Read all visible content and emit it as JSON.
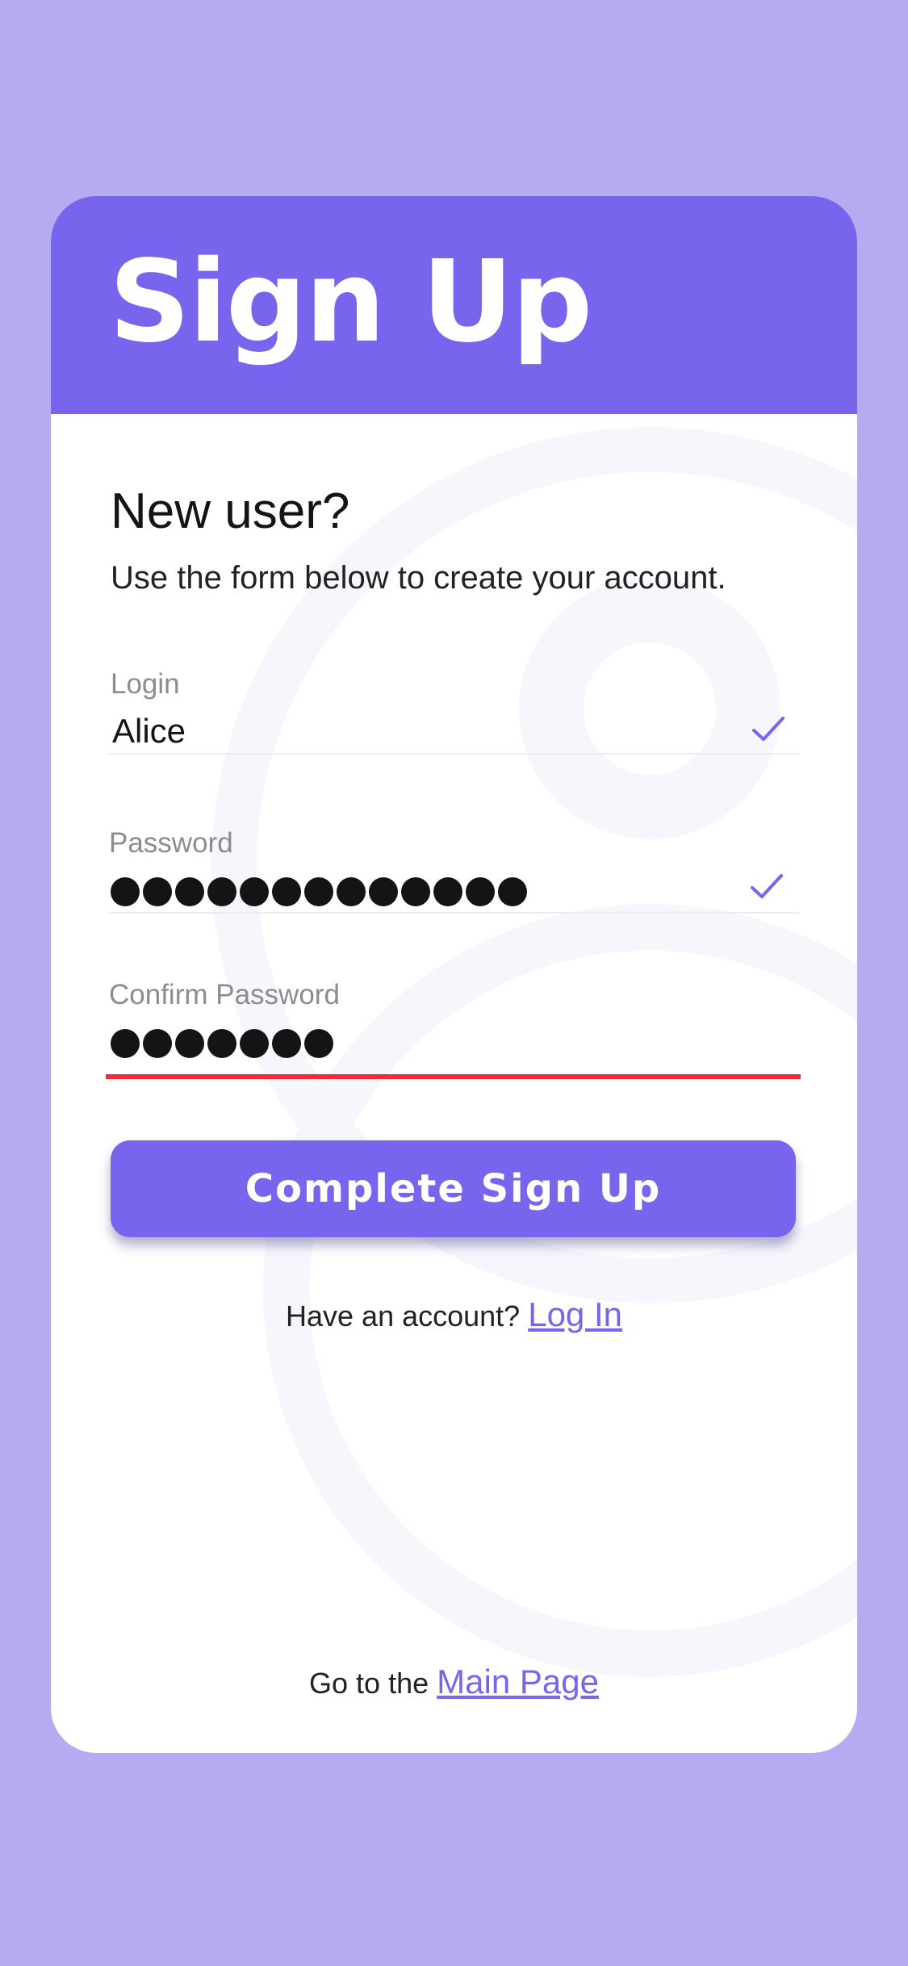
{
  "header": {
    "title": "Sign Up"
  },
  "intro": {
    "heading": "New user?",
    "text": "Use the form below to create your account."
  },
  "form": {
    "login": {
      "label": "Login",
      "value": "Alice",
      "valid": true
    },
    "password": {
      "label": "Password",
      "masked_length": 13,
      "valid": true
    },
    "confirm_password": {
      "label": "Confirm Password",
      "masked_length": 7,
      "error": true
    },
    "submit_label": "Complete Sign Up"
  },
  "account_prompt": {
    "text": "Have an account?",
    "link_label": "Log In"
  },
  "footer": {
    "text": "Go to the",
    "link_label": "Main Page"
  },
  "colors": {
    "page_background": "#b6aaf0",
    "accent": "#7865ee",
    "error": "#f42a34",
    "text": "#141414",
    "label": "#8c8c8c"
  },
  "icons": {
    "valid_indicator": "check-icon"
  }
}
